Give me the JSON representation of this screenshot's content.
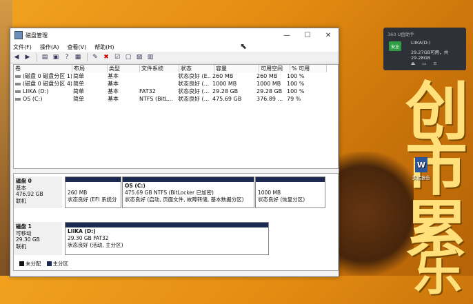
{
  "window": {
    "title": "磁盘管理",
    "menus": [
      "文件(F)",
      "操作(A)",
      "查看(V)",
      "帮助(H)"
    ]
  },
  "volume_table": {
    "headers": [
      "卷",
      "布局",
      "类型",
      "文件系统",
      "状态",
      "容量",
      "可用空间",
      "% 可用"
    ],
    "rows": [
      [
        "(磁盘 0 磁盘分区 1)",
        "简单",
        "基本",
        "",
        "状态良好 (E...",
        "260 MB",
        "260 MB",
        "100 %"
      ],
      [
        "(磁盘 0 磁盘分区 4)",
        "简单",
        "基本",
        "",
        "状态良好 (...",
        "1000 MB",
        "1000 MB",
        "100 %"
      ],
      [
        "LIIKA (D:)",
        "简单",
        "基本",
        "FAT32",
        "状态良好 (...",
        "29.28 GB",
        "29.28 GB",
        "100 %"
      ],
      [
        "OS (C:)",
        "简单",
        "基本",
        "NTFS (BitL...",
        "状态良好 (...",
        "475.69 GB",
        "376.89 ...",
        "79 %"
      ]
    ]
  },
  "disks": [
    {
      "name": "磁盘 0",
      "type": "基本",
      "size": "476.92 GB",
      "status": "联机",
      "partitions": [
        {
          "title": "",
          "line1": "260 MB",
          "line2": "状态良好 (EFI 系统分"
        },
        {
          "title": "OS  (C:)",
          "line1": "475.69 GB NTFS (BitLocker 已加密)",
          "line2": "状态良好 (启动, 页面文件, 故障转储, 基本数据分区)"
        },
        {
          "title": "",
          "line1": "1000 MB",
          "line2": "状态良好 (恢复分区)"
        }
      ]
    },
    {
      "name": "磁盘 1",
      "type": "可移动",
      "size": "29.30 GB",
      "status": "联机",
      "partitions": [
        {
          "title": "LIIKA  (D:)",
          "line1": "29.30 GB FAT32",
          "line2": "状态良好 (活动, 主分区)"
        }
      ]
    }
  ],
  "legend": [
    "未分配",
    "主分区"
  ],
  "notification": {
    "header": "360 U盘助手",
    "badge": "安全",
    "name": "LIIKA(D:)",
    "capacity": "29.27GB可用，共29.28GB"
  },
  "desktop_icon": {
    "label": "实验报告"
  },
  "background_glyphs": [
    "创",
    "市",
    "累",
    "乐"
  ]
}
